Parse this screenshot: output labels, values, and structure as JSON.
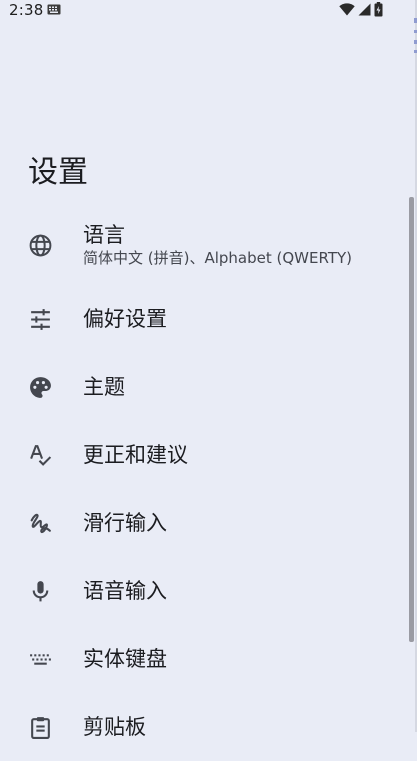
{
  "status_bar": {
    "time": "2:38"
  },
  "page": {
    "title": "设置"
  },
  "settings": {
    "items": [
      {
        "label": "语言",
        "summary": "简体中文 (拼音)、Alphabet (QWERTY)",
        "icon": "globe-icon"
      },
      {
        "label": "偏好设置",
        "icon": "tune-icon"
      },
      {
        "label": "主题",
        "icon": "palette-icon"
      },
      {
        "label": "更正和建议",
        "icon": "spellcheck-icon"
      },
      {
        "label": "滑行输入",
        "icon": "gesture-icon"
      },
      {
        "label": "语音输入",
        "icon": "mic-icon"
      },
      {
        "label": "实体键盘",
        "icon": "keyboard-icon"
      },
      {
        "label": "剪贴板",
        "icon": "clipboard-icon"
      }
    ]
  },
  "colors": {
    "background": "#e9ecf6",
    "text_primary": "#1b1c20",
    "text_secondary": "#44474f",
    "icon": "#44474f"
  }
}
